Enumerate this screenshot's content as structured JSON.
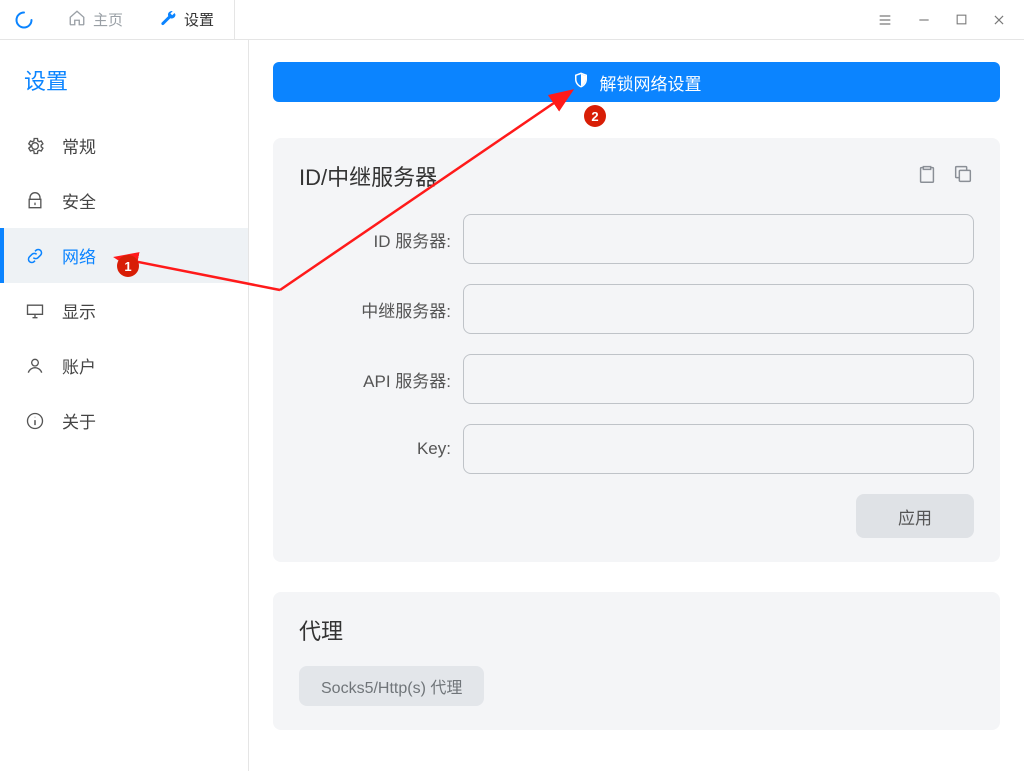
{
  "tabs": {
    "home": "主页",
    "settings": "设置"
  },
  "window_controls": {
    "menu": "menu-icon",
    "minimize": "minimize-icon",
    "maximize": "maximize-icon",
    "close": "close-icon"
  },
  "sidebar": {
    "title": "设置",
    "items": [
      {
        "label": "常规",
        "icon": "gear-icon"
      },
      {
        "label": "安全",
        "icon": "lock-icon"
      },
      {
        "label": "网络",
        "icon": "link-icon",
        "selected": true
      },
      {
        "label": "显示",
        "icon": "monitor-icon"
      },
      {
        "label": "账户",
        "icon": "person-icon"
      },
      {
        "label": "关于",
        "icon": "info-icon"
      }
    ]
  },
  "main": {
    "unlock_button": "解锁网络设置",
    "server_card": {
      "title": "ID/中继服务器",
      "paste_icon": "clipboard-icon",
      "copy_icon": "copy-icon",
      "fields": {
        "id_server_label": "ID 服务器:",
        "relay_server_label": "中继服务器:",
        "api_server_label": "API 服务器:",
        "key_label": "Key:",
        "id_server_value": "",
        "relay_server_value": "",
        "api_server_value": "",
        "key_value": ""
      },
      "apply_button": "应用"
    },
    "proxy_card": {
      "title": "代理",
      "chip_label": "Socks5/Http(s) 代理"
    }
  },
  "annotations": {
    "badge1": "1",
    "badge2": "2"
  }
}
